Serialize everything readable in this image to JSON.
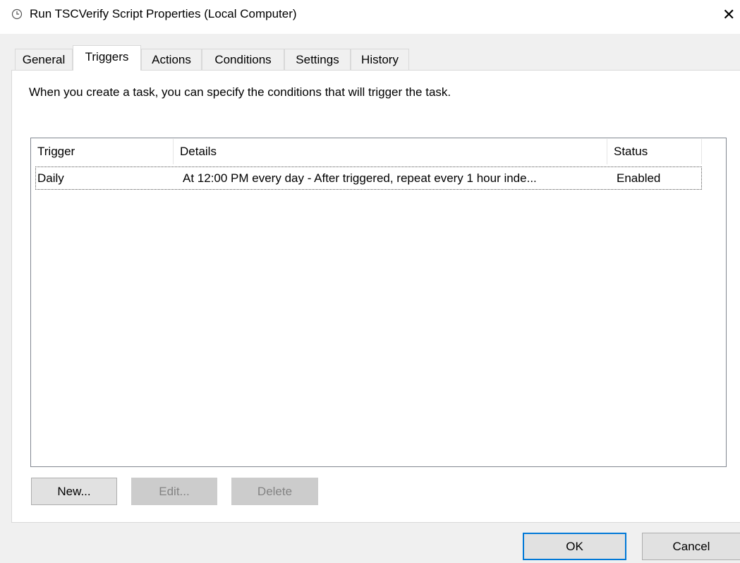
{
  "window": {
    "title": "Run TSCVerify Script Properties (Local Computer)",
    "close_glyph": "✕"
  },
  "tabs": [
    {
      "label": "General",
      "selected": false
    },
    {
      "label": "Triggers",
      "selected": true
    },
    {
      "label": "Actions",
      "selected": false
    },
    {
      "label": "Conditions",
      "selected": false
    },
    {
      "label": "Settings",
      "selected": false
    },
    {
      "label": "History",
      "selected": false
    }
  ],
  "triggers_tab": {
    "description": "When you create a task, you can specify the conditions that will trigger the task.",
    "columns": [
      "Trigger",
      "Details",
      "Status"
    ],
    "rows": [
      {
        "trigger": "Daily",
        "details": "At 12:00 PM every day - After triggered, repeat every 1 hour inde...",
        "status": "Enabled"
      }
    ],
    "buttons": {
      "new": "New...",
      "edit": "Edit...",
      "delete": "Delete"
    }
  },
  "dialog_buttons": {
    "ok": "OK",
    "cancel": "Cancel"
  },
  "icons": {
    "title": "clock-icon",
    "close": "close-icon"
  },
  "colors": {
    "accent": "#0078d7",
    "dialog_bg": "#f0f0f0",
    "panel_bg": "#ffffff",
    "disabled_text": "#838383"
  }
}
